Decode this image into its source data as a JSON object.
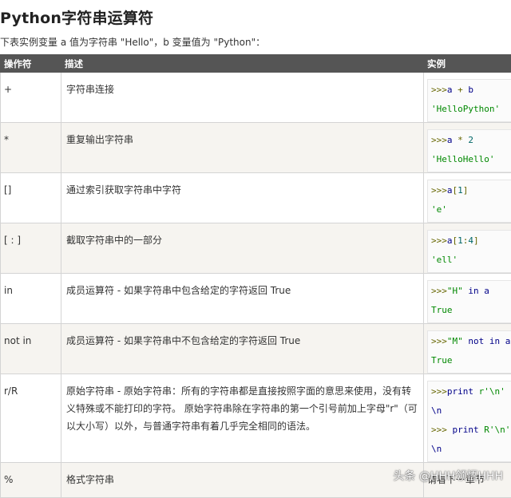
{
  "page": {
    "title": "Python字符串运算符",
    "intro": "下表实例变量 a 值为字符串 \"Hello\"，b 变量值为 \"Python\"："
  },
  "table": {
    "headers": [
      "操作符",
      "描述",
      "实例"
    ],
    "rows": [
      {
        "op": "+",
        "desc": "字符串连接",
        "ex_line1": [
          ">>>",
          "a",
          " + ",
          "b"
        ],
        "ex_line2": [
          "'HelloPython'"
        ]
      },
      {
        "op": "*",
        "desc": "重复输出字符串",
        "ex_line1": [
          ">>>",
          "a",
          " * ",
          "2"
        ],
        "ex_line2": [
          "'HelloHello'"
        ]
      },
      {
        "op": "[]",
        "desc": "通过索引获取字符串中字符",
        "ex_line1": [
          ">>>",
          "a",
          "[",
          "1",
          "]"
        ],
        "ex_line2": [
          "'e'"
        ]
      },
      {
        "op": "[ : ]",
        "desc": "截取字符串中的一部分",
        "ex_line1": [
          ">>>",
          "a",
          "[",
          "1",
          ":",
          "4",
          "]"
        ],
        "ex_line2": [
          "'ell'"
        ]
      },
      {
        "op": "in",
        "desc": "成员运算符 - 如果字符串中包含给定的字符返回 True",
        "ex_line1": [
          ">>>",
          "\"H\"",
          " in ",
          "a"
        ],
        "ex_line2": [
          "True"
        ]
      },
      {
        "op": "not in",
        "desc": "成员运算符 - 如果字符串中不包含给定的字符返回 True",
        "ex_line1": [
          ">>>",
          "\"M\"",
          " not in ",
          "a"
        ],
        "ex_line2": [
          "True"
        ]
      },
      {
        "op": "r/R",
        "desc": "原始字符串 - 原始字符串：所有的字符串都是直接按照字面的意思来使用，没有转义特殊或不能打印的字符。 原始字符串除在字符串的第一个引号前加上字母\"r\"（可以大小写）以外，与普通字符串有着几乎完全相同的语法。",
        "ex_line1": [
          ">>>",
          "print ",
          "r'\\n'"
        ],
        "ex_line2": [
          "\\n"
        ],
        "ex_line3": [
          ">>> ",
          "print ",
          "R'\\n'"
        ],
        "ex_line4": [
          "\\n"
        ]
      },
      {
        "op": "%",
        "desc": "格式字符串",
        "ex_text": "请看下一章节"
      }
    ]
  },
  "watermark": "头条 @HHH领悟HHH"
}
